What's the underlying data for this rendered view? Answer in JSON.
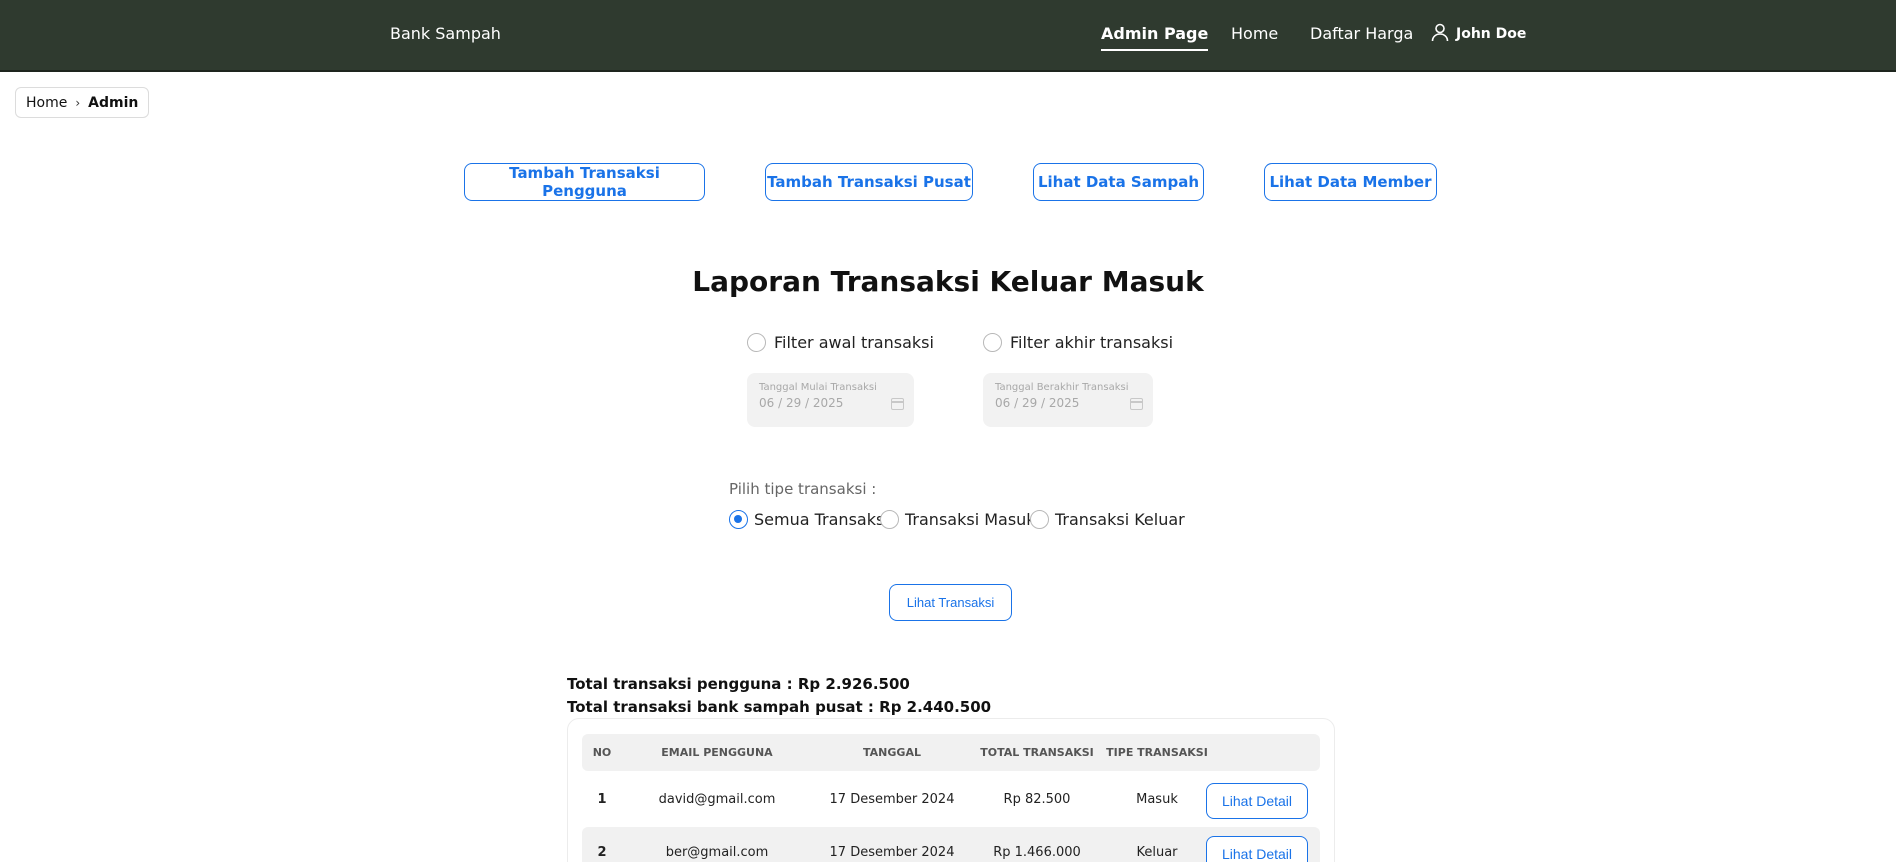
{
  "navbar": {
    "brand": "Bank Sampah",
    "links": {
      "admin": "Admin Page",
      "home": "Home",
      "harga": "Daftar Harga"
    },
    "user": "John Doe",
    "bg_color": "#2f3a2f"
  },
  "breadcrumb": {
    "home": "Home",
    "current": "Admin"
  },
  "actions": {
    "tambah_pengguna": "Tambah Transaksi Pengguna",
    "tambah_pusat": "Tambah Transaksi Pusat",
    "lihat_sampah": "Lihat Data Sampah",
    "lihat_member": "Lihat Data Member"
  },
  "report": {
    "title": "Laporan Transaksi Keluar Masuk",
    "filter_awal_label": "Filter awal transaksi",
    "filter_akhir_label": "Filter akhir transaksi",
    "filter_awal_checked": false,
    "filter_akhir_checked": false,
    "start_date": {
      "label": "Tanggal Mulai Transaksi",
      "month": "06",
      "day": "29",
      "year": "2025"
    },
    "end_date": {
      "label": "Tanggal Berakhir Transaksi",
      "month": "06",
      "day": "29",
      "year": "2025"
    },
    "type_label": "Pilih tipe transaksi :",
    "type_options": [
      "Semua Transaksi",
      "Transaksi Masuk",
      "Transaksi Keluar"
    ],
    "selected_type": "Semua Transaksi",
    "submit_label": "Lihat Transaksi"
  },
  "totals": {
    "pengguna": "Total transaksi pengguna : Rp 2.926.500",
    "pusat": "Total transaksi bank sampah pusat : Rp 2.440.500"
  },
  "table": {
    "headers": [
      "NO",
      "EMAIL PENGGUNA",
      "TANGGAL",
      "TOTAL TRANSAKSI",
      "TIPE TRANSAKSI"
    ],
    "rows": [
      {
        "no": "1",
        "email": "david@gmail.com",
        "tanggal": "17 Desember 2024",
        "total": "Rp 82.500",
        "tipe": "Masuk",
        "action": "Lihat Detail"
      },
      {
        "no": "2",
        "email": "ber@gmail.com",
        "tanggal": "17 Desember 2024",
        "total": "Rp 1.466.000",
        "tipe": "Keluar",
        "action": "Lihat Detail"
      }
    ]
  },
  "accent_color": "#1a73e8"
}
